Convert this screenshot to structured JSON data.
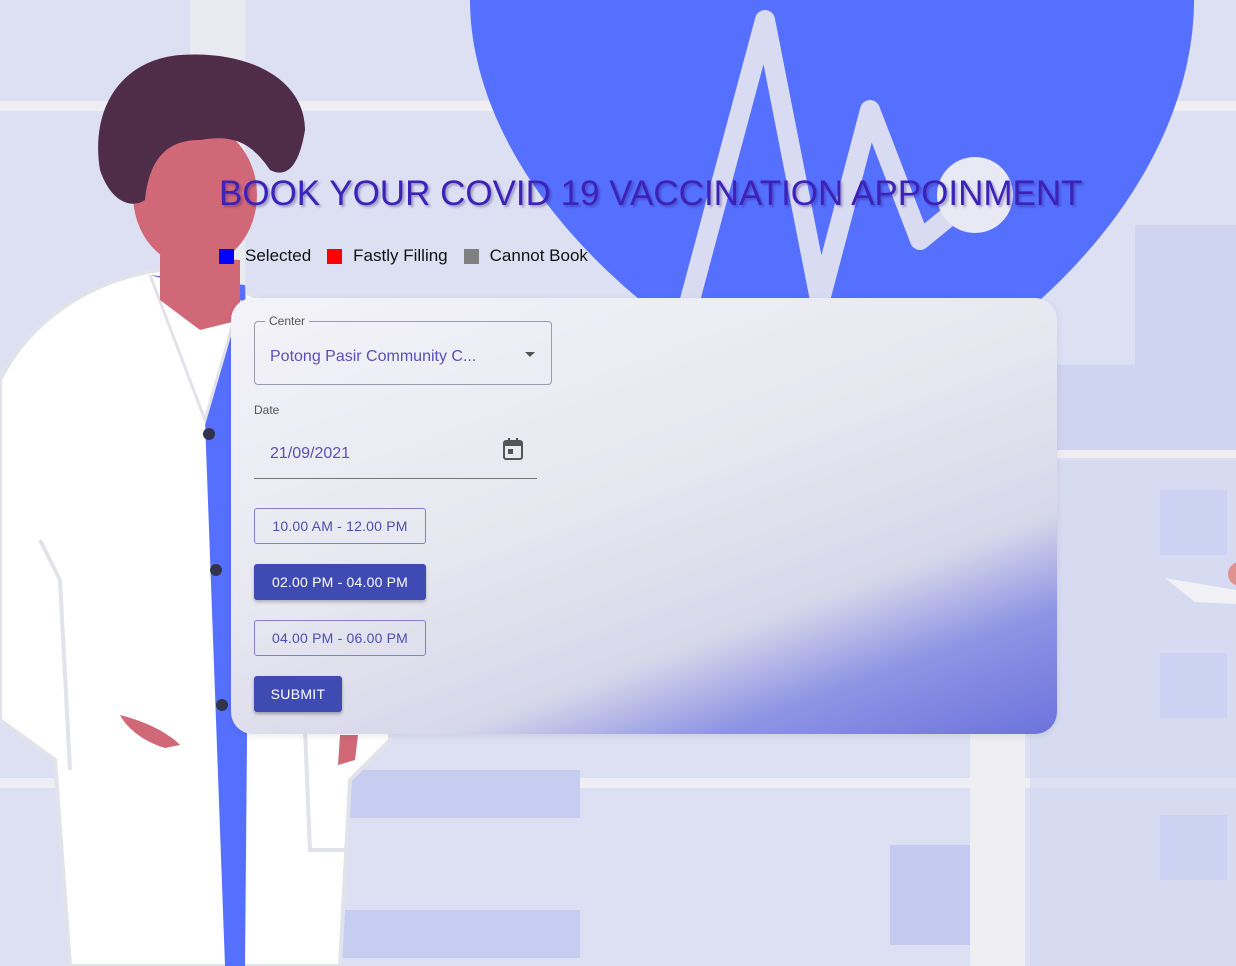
{
  "page": {
    "title": "BOOK YOUR COVID 19 VACCINATION APPOINMENT"
  },
  "legend": [
    {
      "label": "Selected",
      "color": "#0000ff"
    },
    {
      "label": "Fastly Filling",
      "color": "#ff0000"
    },
    {
      "label": "Cannot Book",
      "color": "#808080"
    }
  ],
  "form": {
    "center_label": "Center",
    "center_value": "Potong Pasir Community C...",
    "date_label": "Date",
    "date_value": "21/09/2021",
    "slots": [
      {
        "label": "10.00 AM - 12.00 PM",
        "selected": false
      },
      {
        "label": "02.00 PM - 04.00 PM",
        "selected": true
      },
      {
        "label": "04.00 PM - 06.00 PM",
        "selected": false
      }
    ],
    "submit_label": "SUBMIT"
  },
  "icons": {
    "dropdown": "chevron-down-icon",
    "calendar": "calendar-icon",
    "illustration": "doctor-illustration"
  },
  "colors": {
    "accent": "#3f4ab2",
    "title": "#3c22b6",
    "heart": "#5570ff",
    "background": "#dde0f2"
  }
}
